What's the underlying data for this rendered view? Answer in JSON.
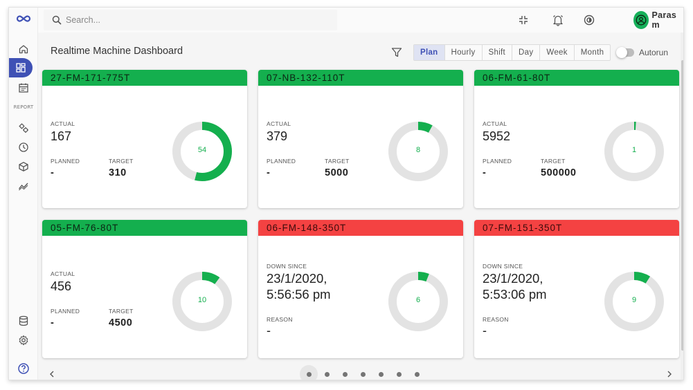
{
  "search": {
    "placeholder": "Search..."
  },
  "user": {
    "name": "Paras m"
  },
  "page": {
    "title": "Realtime Machine Dashboard"
  },
  "sidebar": {
    "report_label": "REPORT"
  },
  "range_tabs": [
    "Plan",
    "Hourly",
    "Shift",
    "Day",
    "Week",
    "Month"
  ],
  "active_tab": "Plan",
  "autorun": {
    "label": "Autorun",
    "enabled": false
  },
  "labels": {
    "actual": "ACTUAL",
    "planned": "PLANNED",
    "target": "TARGET",
    "down_since": "DOWN SINCE",
    "reason": "REASON"
  },
  "colors": {
    "running": "#14af4e",
    "down": "#f44242",
    "accent": "#3f51b5"
  },
  "machines": [
    {
      "id": "27-FM-171-775T",
      "status": "running",
      "actual": "167",
      "planned": "-",
      "target": "310",
      "percent": "54"
    },
    {
      "id": "07-NB-132-110T",
      "status": "running",
      "actual": "379",
      "planned": "-",
      "target": "5000",
      "percent": "8"
    },
    {
      "id": "06-FM-61-80T",
      "status": "running",
      "actual": "5952",
      "planned": "-",
      "target": "500000",
      "percent": "1"
    },
    {
      "id": "05-FM-76-80T",
      "status": "running",
      "actual": "456",
      "planned": "-",
      "target": "4500",
      "percent": "10"
    },
    {
      "id": "06-FM-148-350T",
      "status": "down",
      "down_since_date": "23/1/2020,",
      "down_since_time": "5:56:56 pm",
      "reason": "-",
      "percent": "6"
    },
    {
      "id": "07-FM-151-350T",
      "status": "down",
      "down_since_date": "23/1/2020,",
      "down_since_time": "5:53:06 pm",
      "reason": "-",
      "percent": "9"
    }
  ],
  "pagination": {
    "pages": 7,
    "current": 1
  }
}
